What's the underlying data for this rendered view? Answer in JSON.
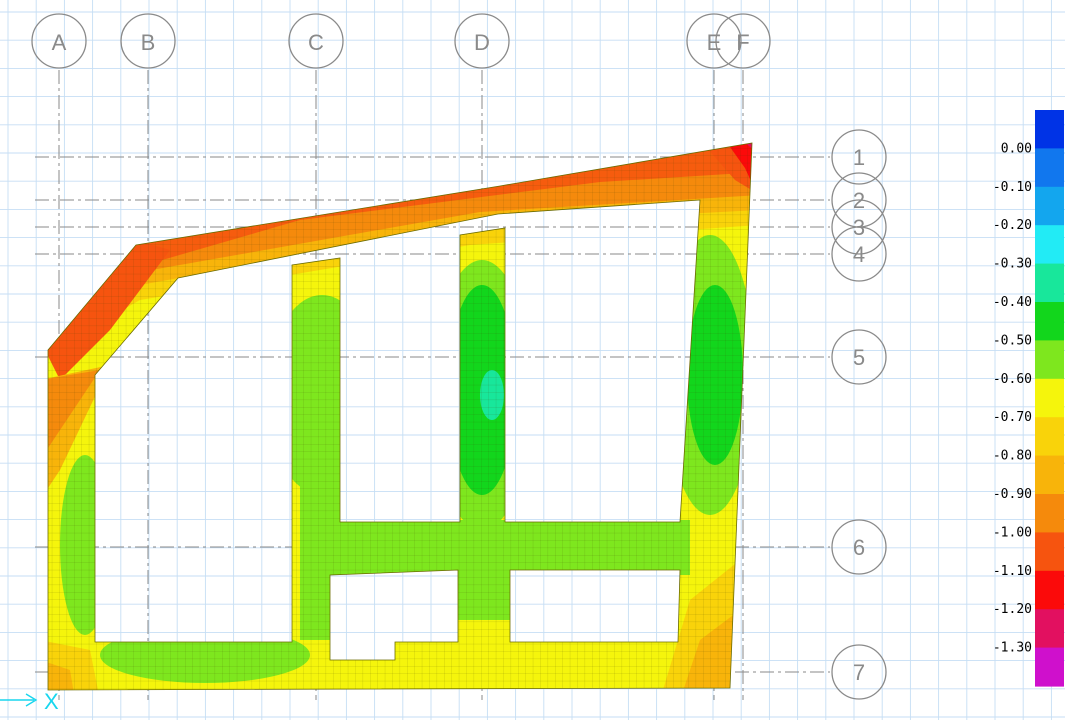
{
  "gridlines_x": {
    "labels": [
      "A",
      "B",
      "C",
      "D",
      "E",
      "F"
    ]
  },
  "gridlines_y": {
    "labels": [
      "1",
      "2",
      "3",
      "4",
      "5",
      "6",
      "7"
    ]
  },
  "legend": {
    "labels": [
      "0.00",
      "-0.10",
      "-0.20",
      "-0.30",
      "-0.40",
      "-0.50",
      "-0.60",
      "-0.70",
      "-0.80",
      "-0.90",
      "-1.00",
      "-1.10",
      "-1.20",
      "-1.30"
    ],
    "colors": [
      "#0033e6",
      "#1177ee",
      "#13a6ee",
      "#22ebf5",
      "#18e79b",
      "#12d61c",
      "#7ee71e",
      "#f5f50c",
      "#f9d30a",
      "#f8b40a",
      "#f58a0c",
      "#f6540f",
      "#fb0a0a",
      "#e21060",
      "#cf10cc"
    ]
  },
  "axis": {
    "x_label": "X",
    "color": "#18d6ee"
  },
  "colors": {
    "grid": "#c6def4",
    "bubble": "#8a8a8a",
    "dash": "#8a8a8a",
    "mesh": "#4a4a00"
  }
}
